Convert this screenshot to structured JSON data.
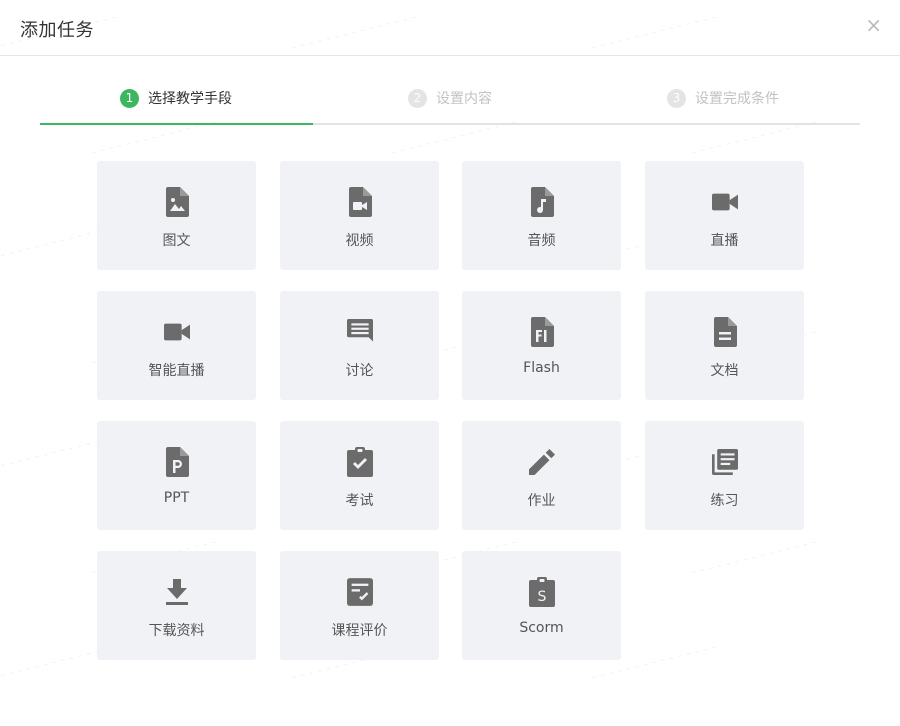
{
  "dialog": {
    "title": "添加任务",
    "close_label": "×"
  },
  "steps": [
    {
      "number": "1",
      "label": "选择教学手段",
      "state": "active"
    },
    {
      "number": "2",
      "label": "设置内容",
      "state": "inactive"
    },
    {
      "number": "3",
      "label": "设置完成条件",
      "state": "inactive"
    }
  ],
  "task_types": [
    {
      "label": "图文",
      "icon": "image-file-icon"
    },
    {
      "label": "视频",
      "icon": "video-file-icon"
    },
    {
      "label": "音频",
      "icon": "audio-file-icon"
    },
    {
      "label": "直播",
      "icon": "video-camera-icon"
    },
    {
      "label": "智能直播",
      "icon": "video-camera-icon"
    },
    {
      "label": "讨论",
      "icon": "comment-icon"
    },
    {
      "label": "Flash",
      "icon": "flash-file-icon"
    },
    {
      "label": "文档",
      "icon": "document-icon"
    },
    {
      "label": "PPT",
      "icon": "ppt-file-icon"
    },
    {
      "label": "考试",
      "icon": "clipboard-check-icon"
    },
    {
      "label": "作业",
      "icon": "pencil-icon"
    },
    {
      "label": "练习",
      "icon": "library-books-icon"
    },
    {
      "label": "下载资料",
      "icon": "download-icon"
    },
    {
      "label": "课程评价",
      "icon": "evaluation-icon"
    },
    {
      "label": "Scorm",
      "icon": "scorm-clipboard-icon"
    }
  ],
  "colors": {
    "accent": "#3cb760",
    "card_bg": "#f0f2f5",
    "icon": "#6b6b6b",
    "step_inactive": "#c2c2c2"
  }
}
